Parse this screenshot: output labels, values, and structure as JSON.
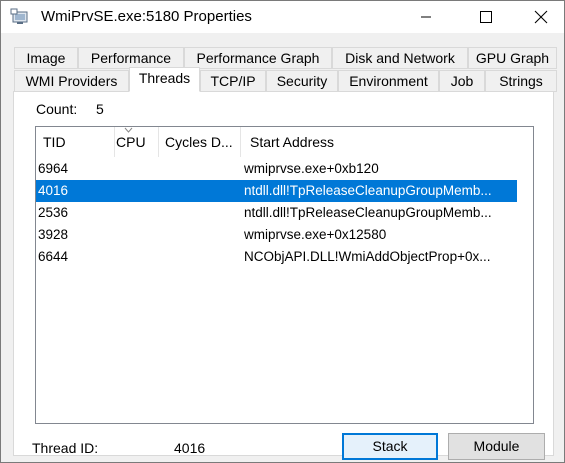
{
  "window": {
    "title": "WmiPrvSE.exe:5180 Properties",
    "accent_color": "#0078d7"
  },
  "tabs_row1": [
    "Image",
    "Performance",
    "Performance Graph",
    "Disk and Network",
    "GPU Graph"
  ],
  "tabs_row2": [
    "WMI Providers",
    "Threads",
    "TCP/IP",
    "Security",
    "Environment",
    "Job",
    "Strings"
  ],
  "active_tab": "Threads",
  "threads": {
    "count_label": "Count:",
    "count_value": "5",
    "columns": [
      "TID",
      "CPU",
      "Cycles D...",
      "Start Address"
    ],
    "rows": [
      {
        "tid": "6964",
        "address": "wmiprvse.exe+0xb120"
      },
      {
        "tid": "4016",
        "address": "ntdll.dll!TpReleaseCleanupGroupMemb..."
      },
      {
        "tid": "2536",
        "address": "ntdll.dll!TpReleaseCleanupGroupMemb..."
      },
      {
        "tid": "3928",
        "address": "wmiprvse.exe+0x12580"
      },
      {
        "tid": "6644",
        "address": "NCObjAPI.DLL!WmiAddObjectProp+0x..."
      }
    ],
    "selected_row": 1
  },
  "footer": {
    "thread_id_label": "Thread ID:",
    "thread_id_value": "4016",
    "stack_label": "Stack",
    "module_label": "Module"
  }
}
